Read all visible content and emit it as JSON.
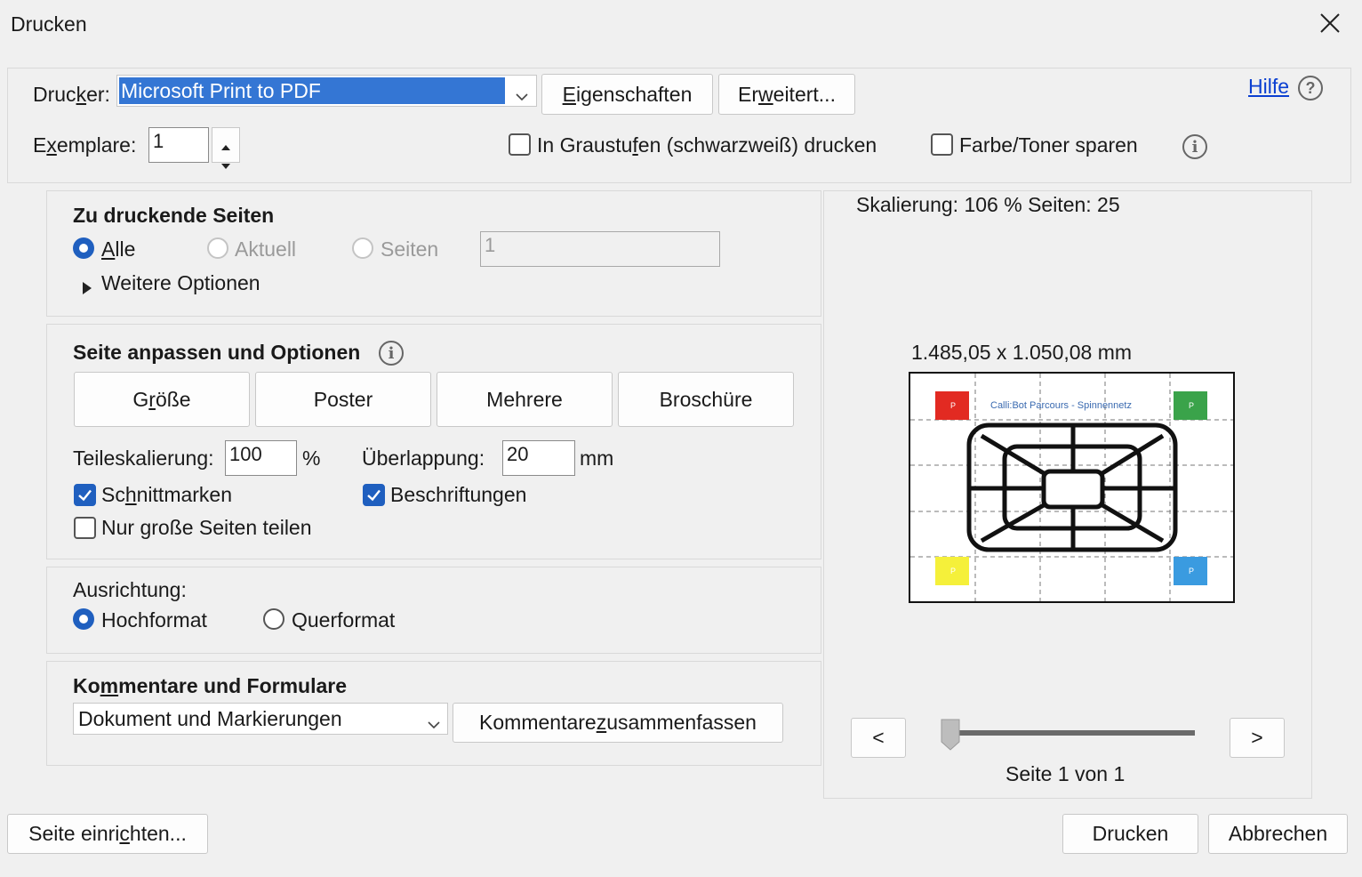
{
  "window": {
    "title": "Drucken"
  },
  "printer": {
    "label_pre": "Druc",
    "label_u": "k",
    "label_post": "er:",
    "selected": "Microsoft Print to PDF",
    "properties_u": "E",
    "properties_rest": "igenschaften",
    "advanced_pre": "Er",
    "advanced_u": "w",
    "advanced_post": "eitert...",
    "help": "Hilfe"
  },
  "copies": {
    "label_pre": "E",
    "label_u": "x",
    "label_post": "emplare:",
    "value": "1",
    "grayscale_pre": "In Graustu",
    "grayscale_u": "f",
    "grayscale_post": "en (schwarzweiß) drucken",
    "grayscale_checked": false,
    "save_toner": "Farbe/Toner sparen",
    "save_toner_checked": false
  },
  "pages": {
    "heading": "Zu druckende Seiten",
    "all_u": "A",
    "all_rest": "lle",
    "current": "Aktuell",
    "pages": "Seiten",
    "pages_value": "1",
    "more": "Weitere Optionen"
  },
  "fit": {
    "heading": "Seite anpassen und Optionen",
    "size_pre": "G",
    "size_u": "r",
    "size_post": "öße",
    "poster": "Poster",
    "multiple": "Mehrere",
    "booklet": "Broschüre",
    "tile_scale_label": "Teileskalierung:",
    "tile_scale_value": "100",
    "tile_scale_unit": "%",
    "overlap_label": "Überlappung:",
    "overlap_value": "20",
    "overlap_unit": "mm",
    "cut_marks_pre": "Sc",
    "cut_marks_u": "h",
    "cut_marks_post": "nittmarken",
    "cut_marks_checked": true,
    "labels": "Beschriftungen",
    "labels_checked": true,
    "large_only": "Nur große Seiten teilen",
    "large_only_checked": false
  },
  "orientation": {
    "heading": "Ausrichtung:",
    "portrait": "Hochformat",
    "landscape": "Querformat",
    "selected": "portrait"
  },
  "comments": {
    "heading_pre": "Ko",
    "heading_u": "m",
    "heading_post": "mentare und Formulare",
    "selected": "Dokument und Markierungen",
    "summarize_pre": "Kommentare ",
    "summarize_u": "z",
    "summarize_post": "usammenfassen"
  },
  "preview": {
    "scaling": "Skalierung: 106 % Seiten: 25",
    "size": "1.485,05 x 1.050,08 mm",
    "doc_title": "Calli:Bot Parcours - Spinnennetz",
    "marker_letter": "P",
    "prev": "<",
    "next": ">",
    "page_info": "Seite 1 von 1",
    "slider_fraction": 0
  },
  "footer": {
    "page_setup_pre": "Seite einri",
    "page_setup_u": "c",
    "page_setup_post": "hten...",
    "print": "Drucken",
    "cancel": "Abbrechen"
  },
  "colors": {
    "accent": "#1f5fbf",
    "link": "#0b3fd1",
    "select": "#3476d4"
  }
}
